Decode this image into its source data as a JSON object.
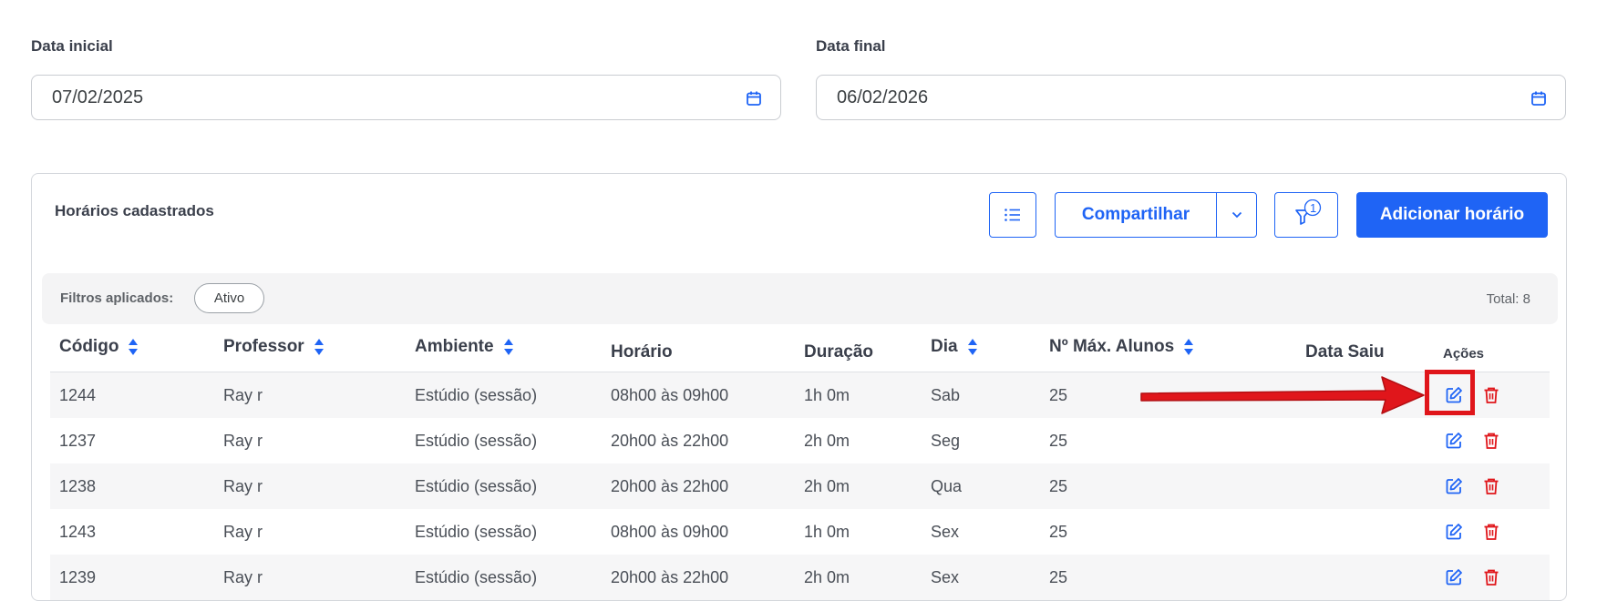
{
  "filters": {
    "start_label": "Data inicial",
    "start_value": "07/02/2025",
    "end_label": "Data final",
    "end_value": "06/02/2026"
  },
  "card": {
    "title": "Horários cadastrados",
    "share_label": "Compartilhar",
    "filter_count": "1",
    "add_label": "Adicionar horário"
  },
  "applied": {
    "label": "Filtros aplicados:",
    "chip": "Ativo",
    "total": "Total: 8"
  },
  "table": {
    "columns": {
      "codigo": "Código",
      "professor": "Professor",
      "ambiente": "Ambiente",
      "horario": "Horário",
      "duracao": "Duração",
      "dia": "Dia",
      "max": "Nº Máx. Alunos",
      "saiu": "Data Saiu",
      "acoes": "Ações"
    },
    "rows": [
      {
        "codigo": "1244",
        "professor": "Ray r",
        "ambiente": "Estúdio (sessão)",
        "horario": "08h00 às 09h00",
        "duracao": "1h 0m",
        "dia": "Sab",
        "max": "25",
        "saiu": ""
      },
      {
        "codigo": "1237",
        "professor": "Ray r",
        "ambiente": "Estúdio (sessão)",
        "horario": "20h00 às 22h00",
        "duracao": "2h 0m",
        "dia": "Seg",
        "max": "25",
        "saiu": ""
      },
      {
        "codigo": "1238",
        "professor": "Ray r",
        "ambiente": "Estúdio (sessão)",
        "horario": "20h00 às 22h00",
        "duracao": "2h 0m",
        "dia": "Qua",
        "max": "25",
        "saiu": ""
      },
      {
        "codigo": "1243",
        "professor": "Ray r",
        "ambiente": "Estúdio (sessão)",
        "horario": "08h00 às 09h00",
        "duracao": "1h 0m",
        "dia": "Sex",
        "max": "25",
        "saiu": ""
      },
      {
        "codigo": "1239",
        "professor": "Ray r",
        "ambiente": "Estúdio (sessão)",
        "horario": "20h00 às 22h00",
        "duracao": "2h 0m",
        "dia": "Sex",
        "max": "25",
        "saiu": ""
      }
    ]
  },
  "colors": {
    "primary": "#1f64f5",
    "danger": "#e0161b",
    "annotation": "#e0161b"
  },
  "icons": [
    "calendar-icon",
    "list-icon",
    "chevron-down-icon",
    "filter-icon",
    "sort-icon",
    "edit-icon",
    "trash-icon",
    "arrow-annotation"
  ]
}
